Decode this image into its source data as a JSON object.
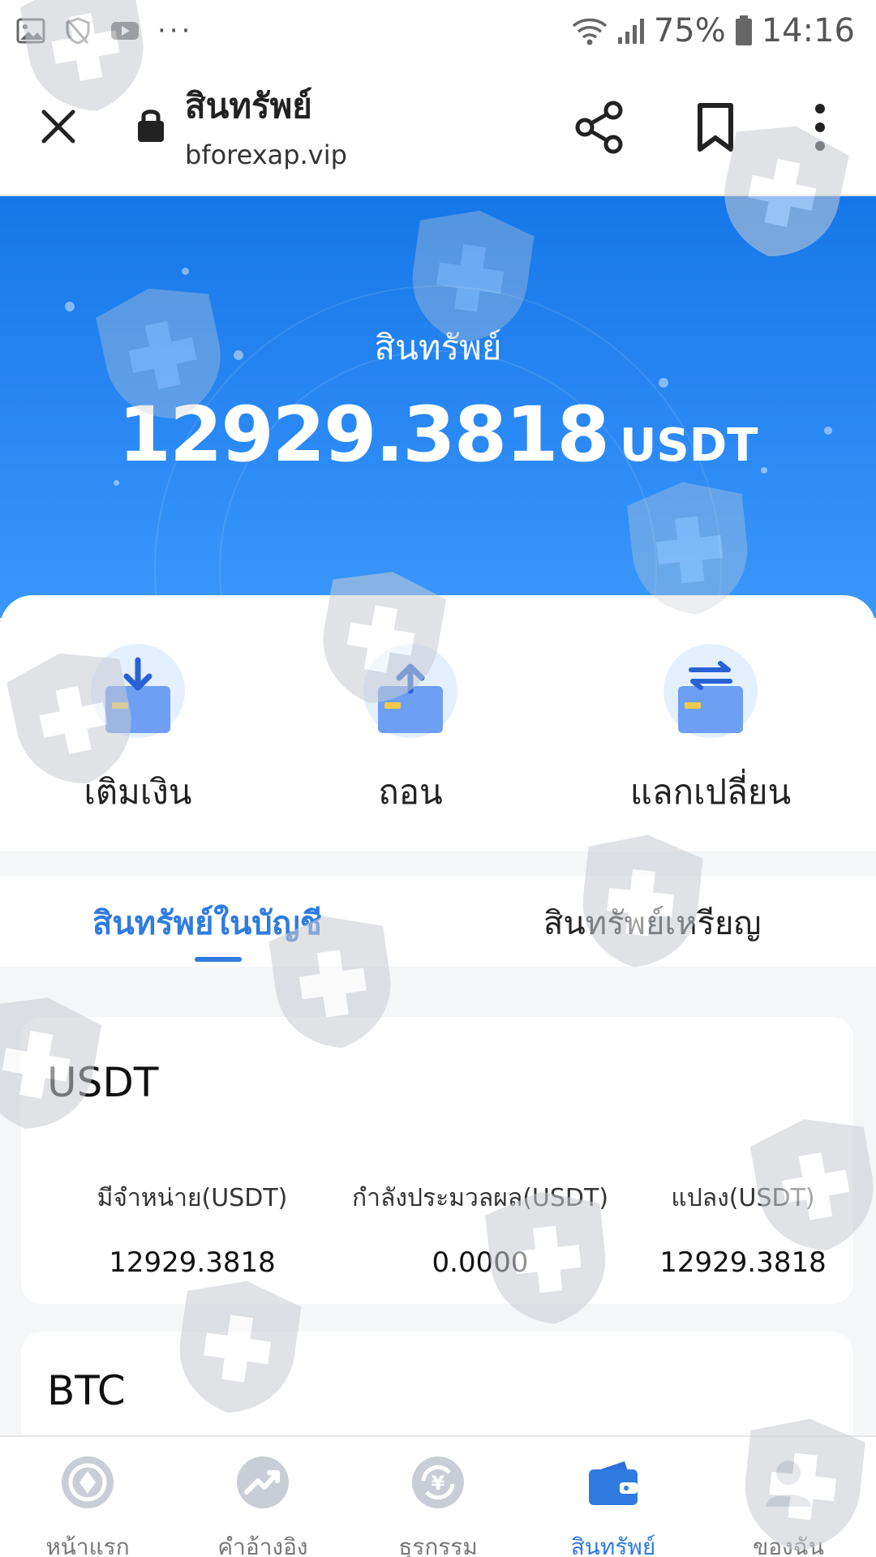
{
  "status_bar": {
    "battery": "75%",
    "time": "14:16",
    "more": "···"
  },
  "browser": {
    "title": "สินทรัพย์",
    "url": "bforexap.vip"
  },
  "hero": {
    "label": "สินทรัพย์",
    "amount": "12929.3818",
    "unit": "USDT"
  },
  "actions": [
    {
      "label": "เติมเงิน",
      "icon": "deposit-icon"
    },
    {
      "label": "ถอน",
      "icon": "withdraw-icon"
    },
    {
      "label": "แลกเปลี่ยน",
      "icon": "exchange-icon"
    }
  ],
  "tabs": [
    {
      "label": "สินทรัพย์ในบัญชี",
      "active": true
    },
    {
      "label": "สินทรัพย์เหรียญ",
      "active": false
    }
  ],
  "assets": [
    {
      "name": "USDT",
      "columns": [
        {
          "header": "มีจำหน่าย(USDT)",
          "value": "12929.3818"
        },
        {
          "header": "กำลังประมวลผล(USDT)",
          "value": "0.0000"
        },
        {
          "header": "แปลง(USDT)",
          "value": "12929.3818"
        }
      ]
    },
    {
      "name": "BTC"
    }
  ],
  "bottom_nav": [
    {
      "label": "หน้าแรก",
      "icon": "home-icon",
      "active": false
    },
    {
      "label": "คำอ้างอิง",
      "icon": "quotes-trend-icon",
      "active": false
    },
    {
      "label": "ธุรกรรม",
      "icon": "transaction-icon",
      "active": false
    },
    {
      "label": "สินทรัพย์",
      "icon": "wallet-icon",
      "active": true
    },
    {
      "label": "ของฉัน",
      "icon": "profile-icon",
      "active": false
    }
  ],
  "colors": {
    "accent": "#2f7be0",
    "hero_blue": "#1677e8",
    "icon_blue": "#6d9ff5",
    "card_yellow": "#f2c94c"
  }
}
